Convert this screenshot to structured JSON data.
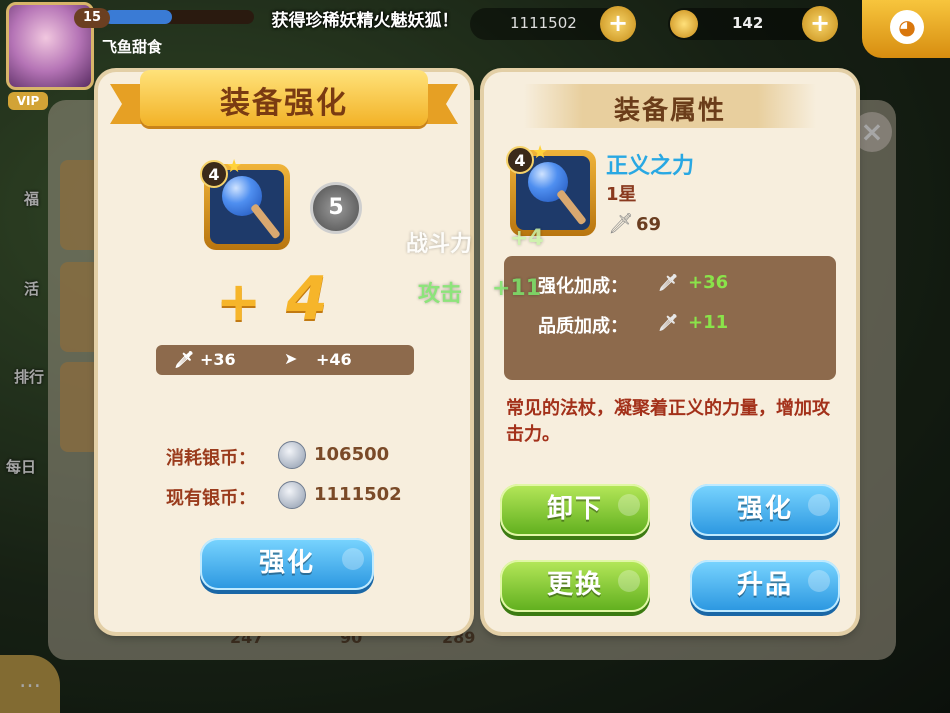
{
  "hud": {
    "level": "15",
    "player_name": "飞鱼甜食",
    "vip_label": "VIP",
    "toast": "获得珍稀妖精火魅妖狐！",
    "silver_count": "1111502",
    "gold_count": "142",
    "xp_fraction": 0.45
  },
  "background": {
    "side_labels": [
      "福",
      "活",
      "排行",
      "每日"
    ],
    "stats": [
      "247",
      "90",
      "289"
    ]
  },
  "enhance_panel": {
    "title": "装备强化",
    "item_level": "4",
    "rank": "5",
    "plus_sign": "+",
    "plus_value": "4",
    "stat_current": "+36",
    "stat_next": "+46",
    "cost_label": "消耗银币：",
    "cost_value": "106500",
    "owned_label": "现有银币：",
    "owned_value": "1111502",
    "enhance_button": "强化"
  },
  "attributes_panel": {
    "title": "装备属性",
    "item_level": "4",
    "item_name": "正义之力",
    "item_star": "1星",
    "item_power": "69",
    "bonus_enhance_label": "强化加成：",
    "bonus_enhance_value": "+36",
    "bonus_quality_label": "品质加成：",
    "bonus_quality_value": "+11",
    "description": "常见的法杖，凝聚着正义的力量，增加攻击力。",
    "buttons": {
      "unequip": "卸下",
      "enhance": "强化",
      "replace": "更换",
      "upgrade": "升品"
    }
  },
  "floating": {
    "combat_power": "战斗力",
    "combat_power_delta": "+4",
    "attack": "攻击",
    "attack_delta": "+11"
  },
  "colors": {
    "accent_blue": "#2a96e0",
    "accent_green": "#5fae1d",
    "gold": "#f6b52a",
    "panel_bg": "#f7eedd"
  }
}
